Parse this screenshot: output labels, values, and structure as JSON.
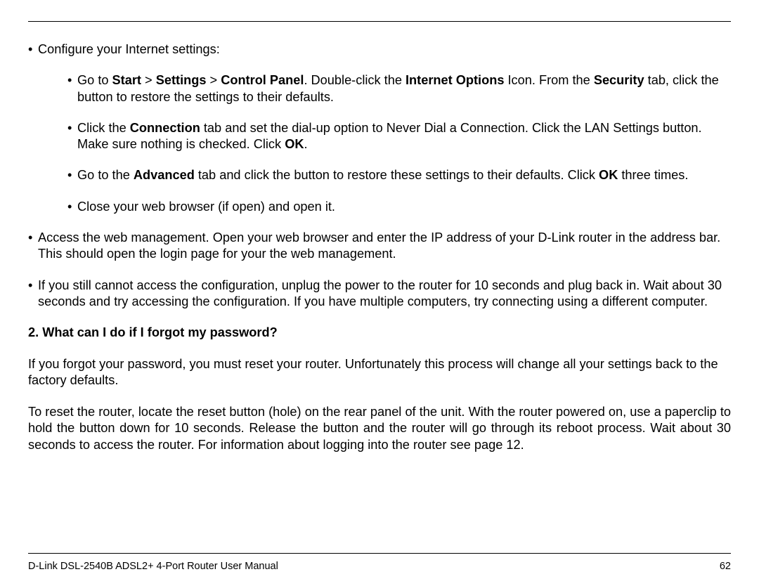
{
  "section1": {
    "intro": "Configure your Internet settings:",
    "sub": {
      "a_pre": "Go to ",
      "a_b1": "Start",
      "a_gt1": " > ",
      "a_b2": "Settings",
      "a_gt2": " > ",
      "a_b3": "Control Panel",
      "a_mid1": ". Double-click the ",
      "a_b4": "Internet Options",
      "a_mid2": " Icon. From the ",
      "a_b5": "Security",
      "a_post": " tab, click the button to restore the settings to their defaults.",
      "b_pre": "Click the ",
      "b_b1": "Connection",
      "b_mid": " tab and set the dial-up option to Never Dial a Connection. Click the LAN Settings button. Make sure nothing is checked. Click ",
      "b_b2": "OK",
      "b_post": ".",
      "c_pre": "Go to the ",
      "c_b1": "Advanced",
      "c_mid": " tab and click the button to restore these settings to their defaults. Click ",
      "c_b2": "OK",
      "c_post": " three times.",
      "d": "Close your web browser (if open) and open it."
    },
    "access": "Access the web management. Open your web browser and enter the IP address of your D-Link router in the address bar. This should open the login page for your the web management.",
    "still": "If you still cannot access the configuration, unplug the power to the router for 10 seconds and plug back in. Wait about 30 seconds and try accessing the configuration. If you have multiple computers, try connecting using a different computer."
  },
  "q2": {
    "heading": "2. What can I do if I forgot my password?",
    "p1": "If you forgot your password, you must reset your router. Unfortunately this process will change all your settings back to the factory defaults.",
    "p2": "To reset the router, locate the reset button (hole) on the rear panel of the unit. With the router powered on, use a paperclip to hold the button down for 10 seconds. Release the button and the router will go through its reboot process. Wait about 30 seconds to access the router. For information about logging into the router see page 12."
  },
  "footer": {
    "left": "D-Link DSL-2540B ADSL2+ 4-Port Router User Manual",
    "right": "62"
  },
  "glyph": {
    "bullet": "•"
  }
}
